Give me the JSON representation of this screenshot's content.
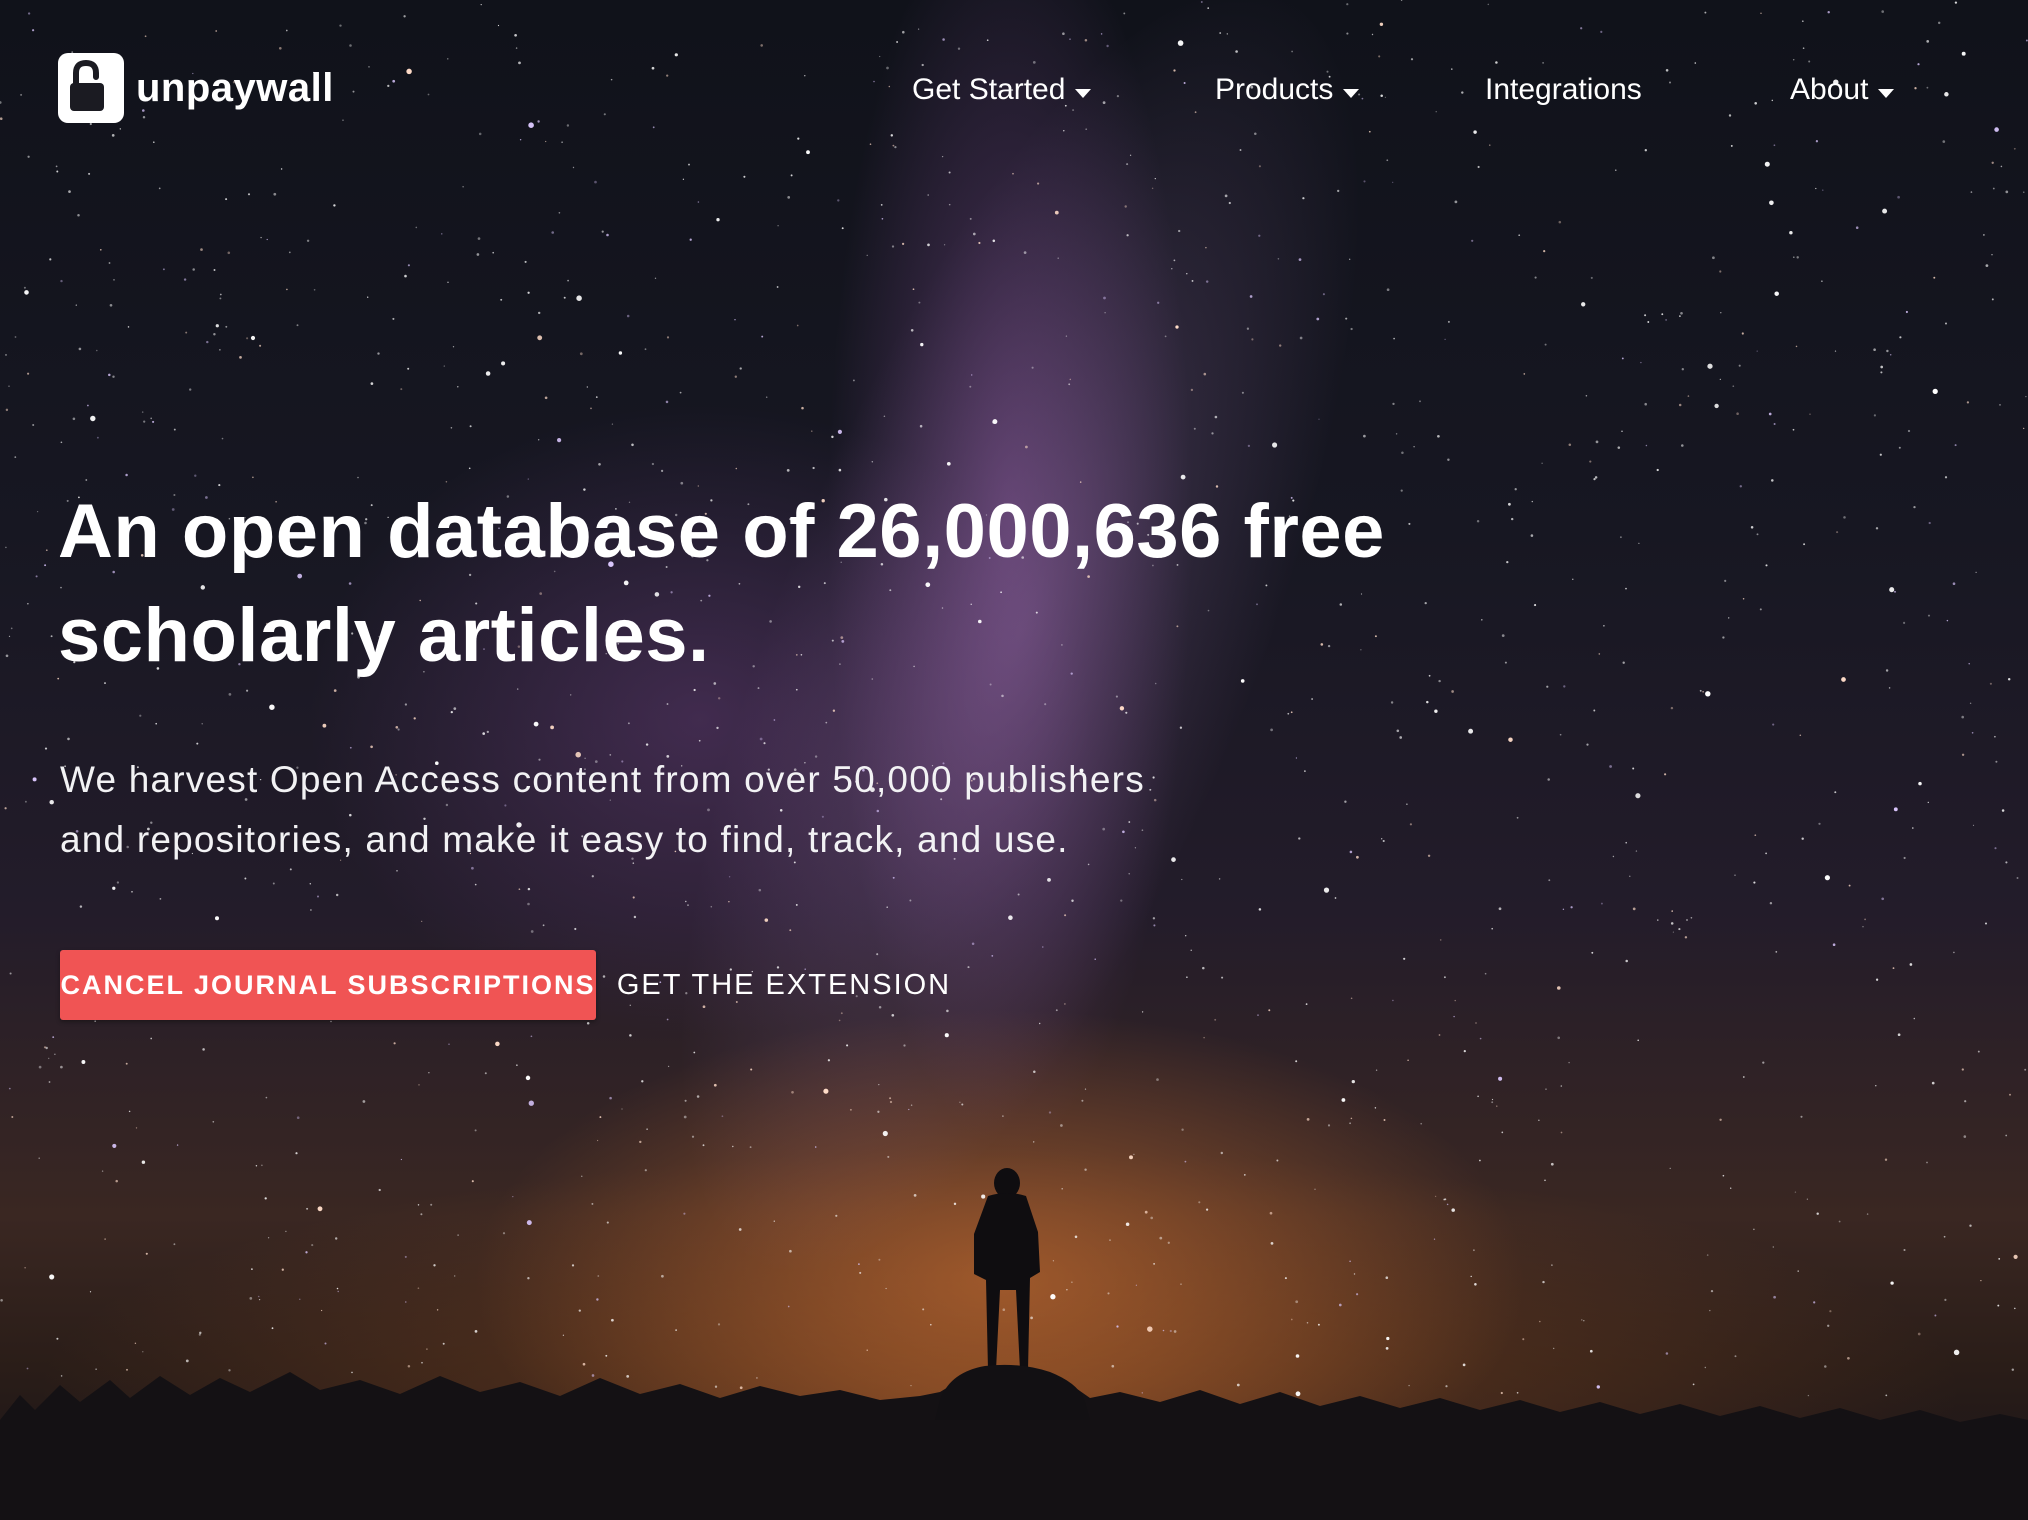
{
  "brand": {
    "name": "unpaywall",
    "logo_icon": "open-padlock-icon",
    "accent_color": "#f05454"
  },
  "nav": {
    "items": [
      {
        "label": "Get Started",
        "has_dropdown": true
      },
      {
        "label": "Products",
        "has_dropdown": true
      },
      {
        "label": "Integrations",
        "has_dropdown": false
      },
      {
        "label": "About",
        "has_dropdown": true
      }
    ]
  },
  "hero": {
    "headline_line1": "An open database of 26,000,636 free",
    "headline_line2": "scholarly articles.",
    "subtext_line1": "We harvest Open Access content from over 50,000 publishers",
    "subtext_line2": "and repositories, and make it easy to find, track, and use.",
    "primary_cta": "CANCEL JOURNAL SUBSCRIPTIONS",
    "secondary_cta": "GET THE EXTENSION",
    "background": "night-sky-milky-way-silhouette-image"
  }
}
